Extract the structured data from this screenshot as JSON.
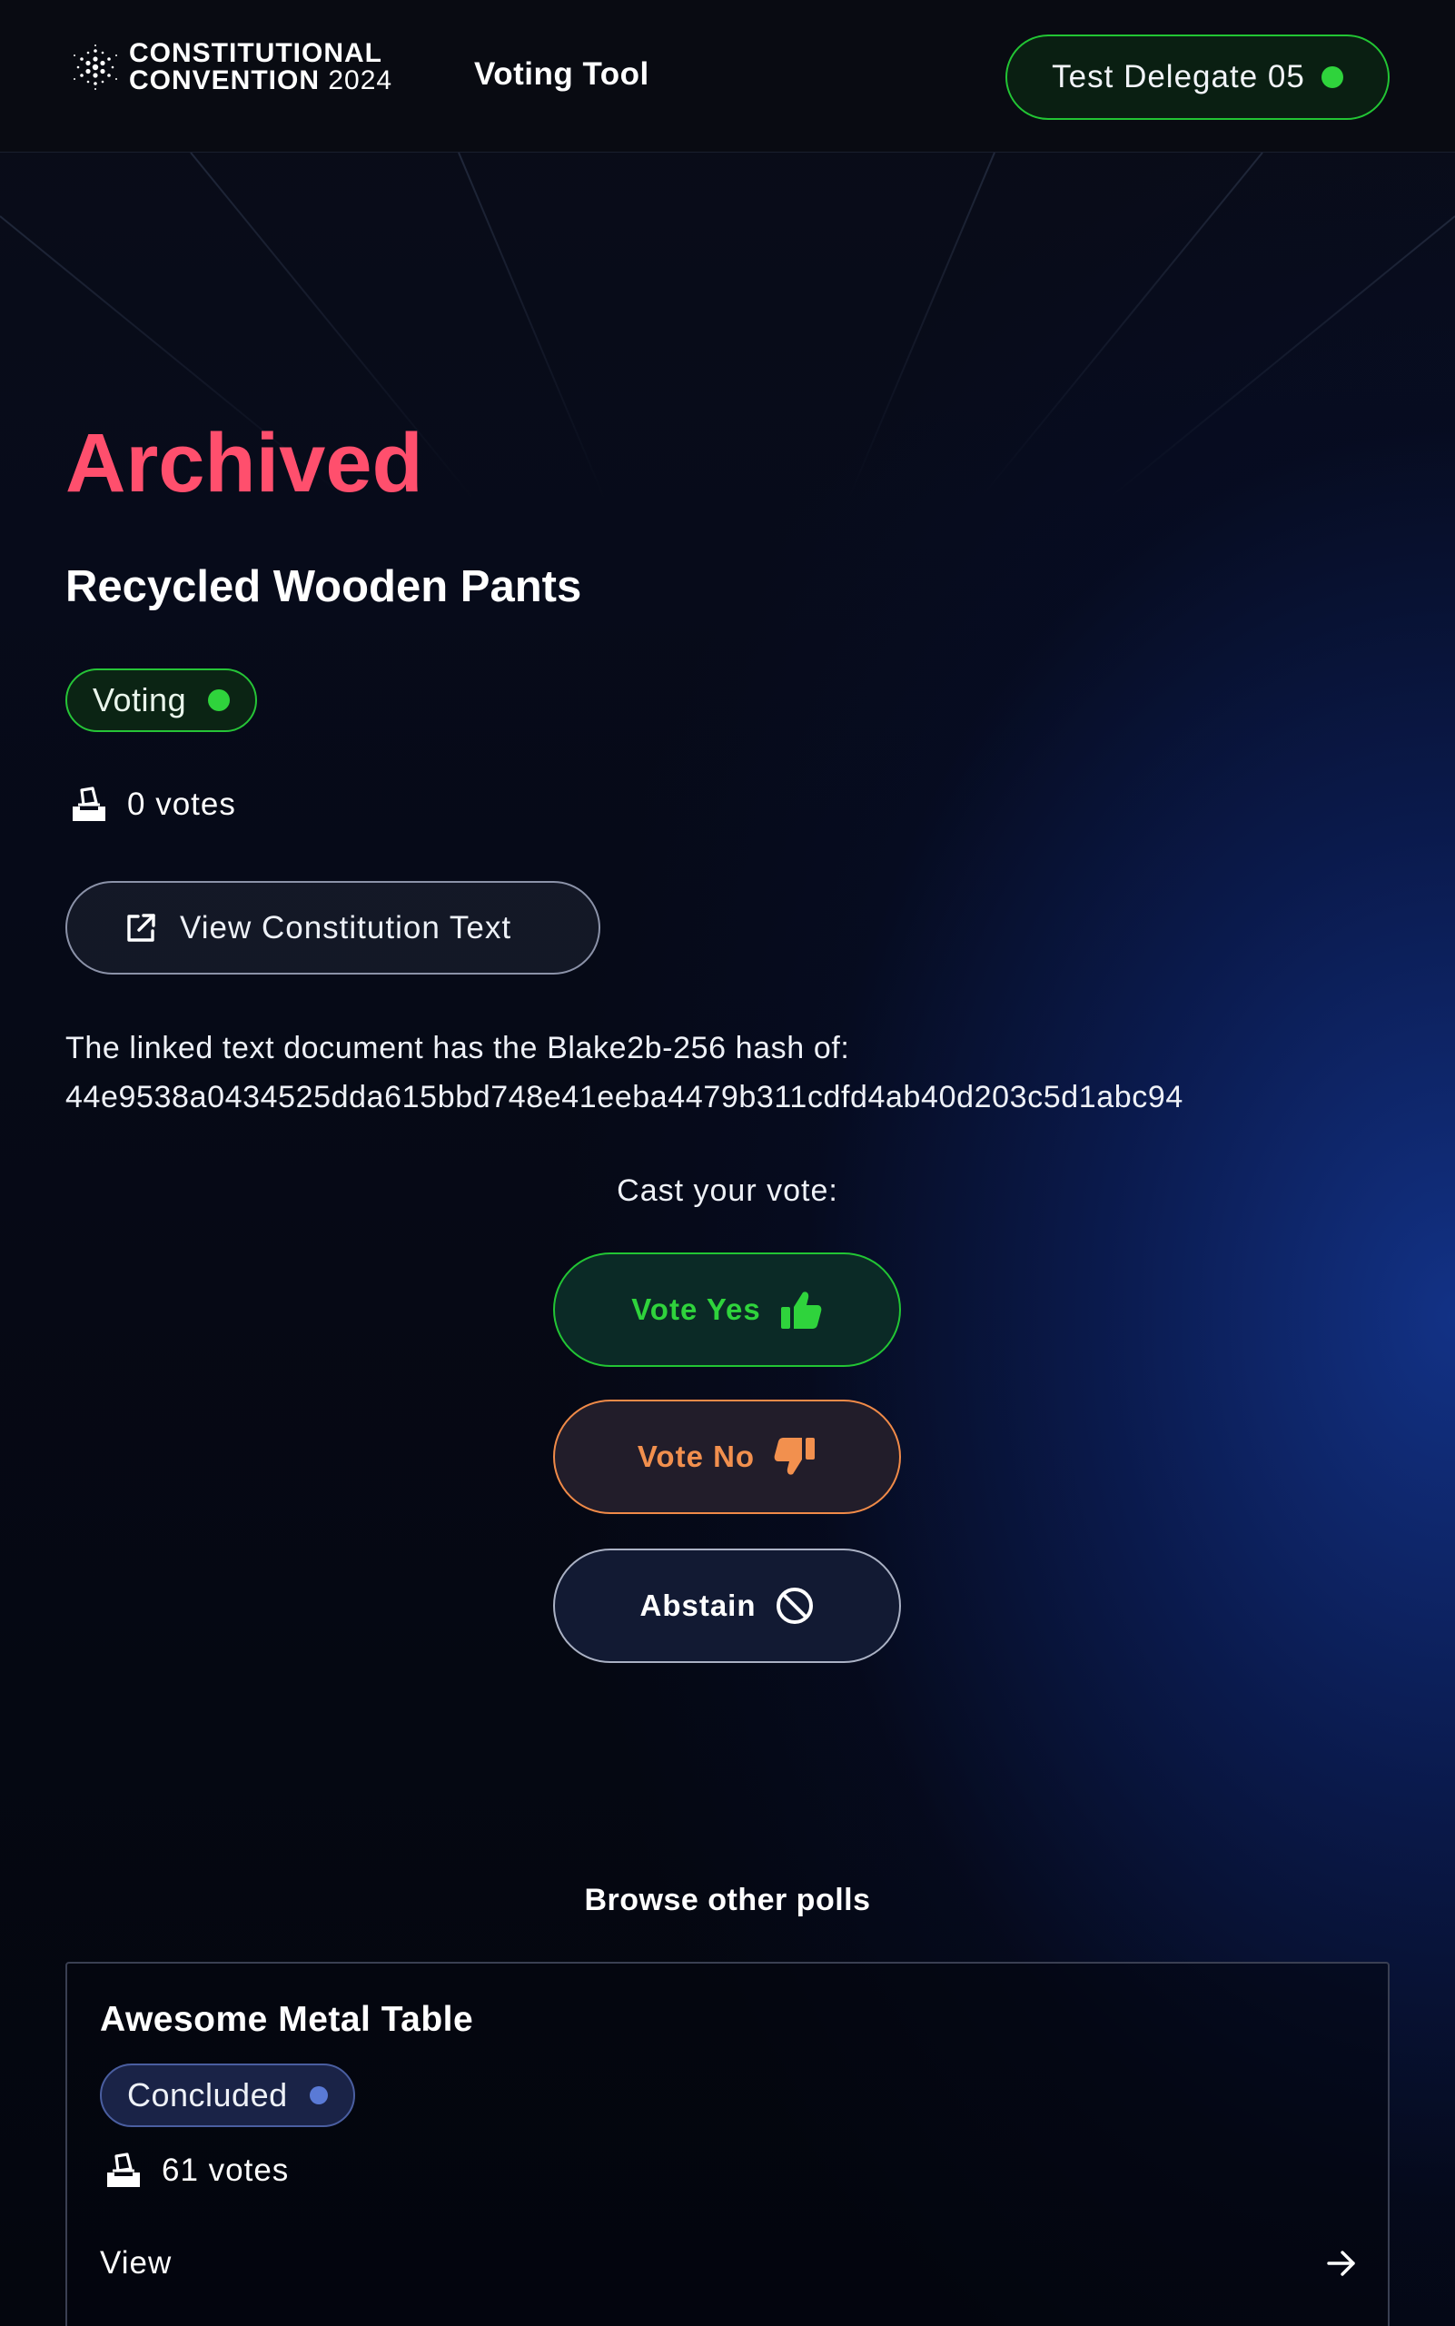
{
  "header": {
    "logo_line1": "CONSTITUTIONAL",
    "logo_line2": "CONVENTION",
    "logo_year": "2024",
    "tool_title": "Voting Tool",
    "delegate_label": "Test Delegate 05"
  },
  "poll": {
    "state_heading": "Archived",
    "title": "Recycled Wooden Pants",
    "status": "Voting",
    "votes": "0 votes",
    "view_text_label": "View Constitution Text",
    "hash_intro": "The linked text document has the Blake2b-256 hash of:",
    "hash_value": "44e9538a0434525dda615bbd748e41eeba4479b311cdfd4ab40d203c5d1abc94"
  },
  "vote": {
    "cast_label": "Cast your vote:",
    "yes_label": "Vote Yes",
    "no_label": "Vote No",
    "abstain_label": "Abstain"
  },
  "browse": {
    "heading": "Browse other polls",
    "cards": [
      {
        "title": "Awesome Metal Table",
        "status": "Concluded",
        "votes": "61 votes",
        "view_label": "View"
      }
    ]
  },
  "colors": {
    "archived": "#ff4f6d",
    "voting_green": "#2fd33c",
    "vote_no_orange": "#f2904e",
    "concluded_blue": "#5a7ad6"
  },
  "icons": [
    "cardano-logo-icon",
    "ballot-box-icon",
    "external-link-icon",
    "thumbs-up-icon",
    "thumbs-down-icon",
    "prohibited-icon",
    "arrow-right-icon"
  ]
}
